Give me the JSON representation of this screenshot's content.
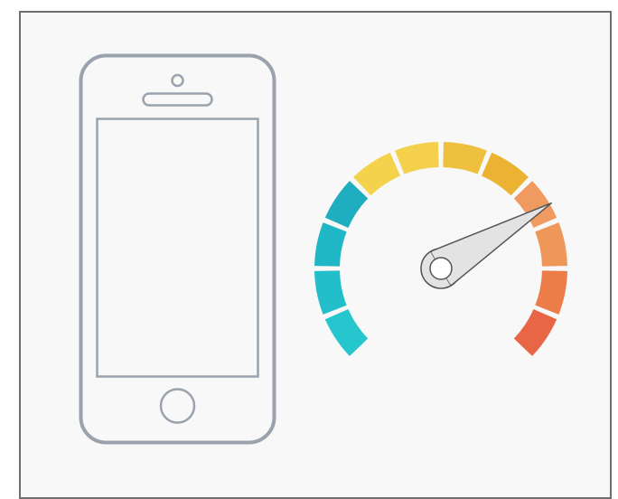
{
  "illustration": {
    "phone": {
      "icon": "smartphone-icon",
      "outline_color": "#9aa3ad"
    },
    "gauge": {
      "icon": "speedometer-gauge-icon",
      "level": 0.72,
      "segment_colors": [
        "#26c6cf",
        "#22bfca",
        "#1fb6c6",
        "#1eaebf",
        "#f5d24c",
        "#f4d04d",
        "#efc03e",
        "#ecb232",
        "#f09a62",
        "#ef9659",
        "#ec7c48",
        "#e86645"
      ],
      "needle_fill": "#e3e3e3",
      "needle_stroke": "#555555"
    }
  }
}
